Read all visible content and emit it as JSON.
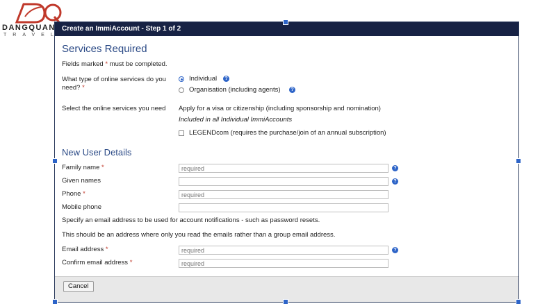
{
  "brand": {
    "name": "DANGQUANG",
    "sub": "TRAVEL"
  },
  "window": {
    "title": "Create an ImmiAccount - Step 1 of 2"
  },
  "services": {
    "heading": "Services Required",
    "fields_note_pre": "Fields marked ",
    "fields_note_star": "*",
    "fields_note_post": " must be completed.",
    "type_question_line1": "What type of online services do you",
    "type_question_line2": "need?",
    "req_star": "*",
    "options": {
      "individual": "Individual",
      "organisation": "Organisation (including agents)"
    },
    "selected": "Individual",
    "select_label": "Select the online services you need",
    "apply_text": "Apply for a visa or citizenship (including sponsorship and nomination)",
    "included_text": "Included in all Individual ImmiAccounts",
    "legend_text": "LEGENDcom (requires the purchase/join of an annual subscription)",
    "help_glyph": "?"
  },
  "user": {
    "heading": "New User Details",
    "family_name": {
      "label": "Family name",
      "placeholder": "required"
    },
    "given_names": {
      "label": "Given names",
      "placeholder": ""
    },
    "phone": {
      "label": "Phone",
      "placeholder": "required"
    },
    "mobile": {
      "label": "Mobile phone",
      "placeholder": ""
    },
    "email_note1": "Specify an email address to be used for account notifications - such as password resets.",
    "email_note2": "This should be an address where only you read the emails rather than a group email address.",
    "email": {
      "label": "Email address",
      "placeholder": "required"
    },
    "confirm_email": {
      "label": "Confirm email address",
      "placeholder": "required"
    }
  },
  "footer": {
    "cancel_label": "Cancel"
  },
  "colors": {
    "titlebar": "#172244",
    "heading": "#2b4a86",
    "accent": "#2d64c8",
    "required": "#c0392b"
  }
}
